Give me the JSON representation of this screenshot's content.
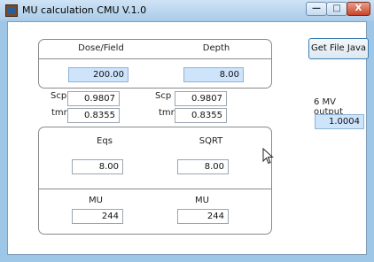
{
  "window": {
    "title": "MU calculation CMU V.1.0",
    "minimize_symbol": "—",
    "maximize_symbol": "□",
    "close_symbol": "X"
  },
  "top_panel": {
    "dose_field_label": "Dose/Field",
    "depth_label": "Depth",
    "dose_field_value": "200.00",
    "depth_value": "8.00"
  },
  "factors": {
    "scp_label_left": "Scp",
    "scp_value_left": "0.9807",
    "tmr_label_left": "tmr",
    "tmr_value_left": "0.8355",
    "scp_label_right": "Scp",
    "scp_value_right": "0.9807",
    "tmr_label_right": "tmr",
    "tmr_value_right": "0.8355"
  },
  "bottom_panel": {
    "eqs_label": "Eqs",
    "sqrt_label": "SQRT",
    "eqs_value": "8.00",
    "sqrt_value": "8.00",
    "mu_label_left": "MU",
    "mu_label_right": "MU",
    "mu_value_left": "244",
    "mu_value_right": "244"
  },
  "side": {
    "button_label": "Get File Java",
    "output_label": "6 MV output",
    "output_value": "1.0004"
  }
}
